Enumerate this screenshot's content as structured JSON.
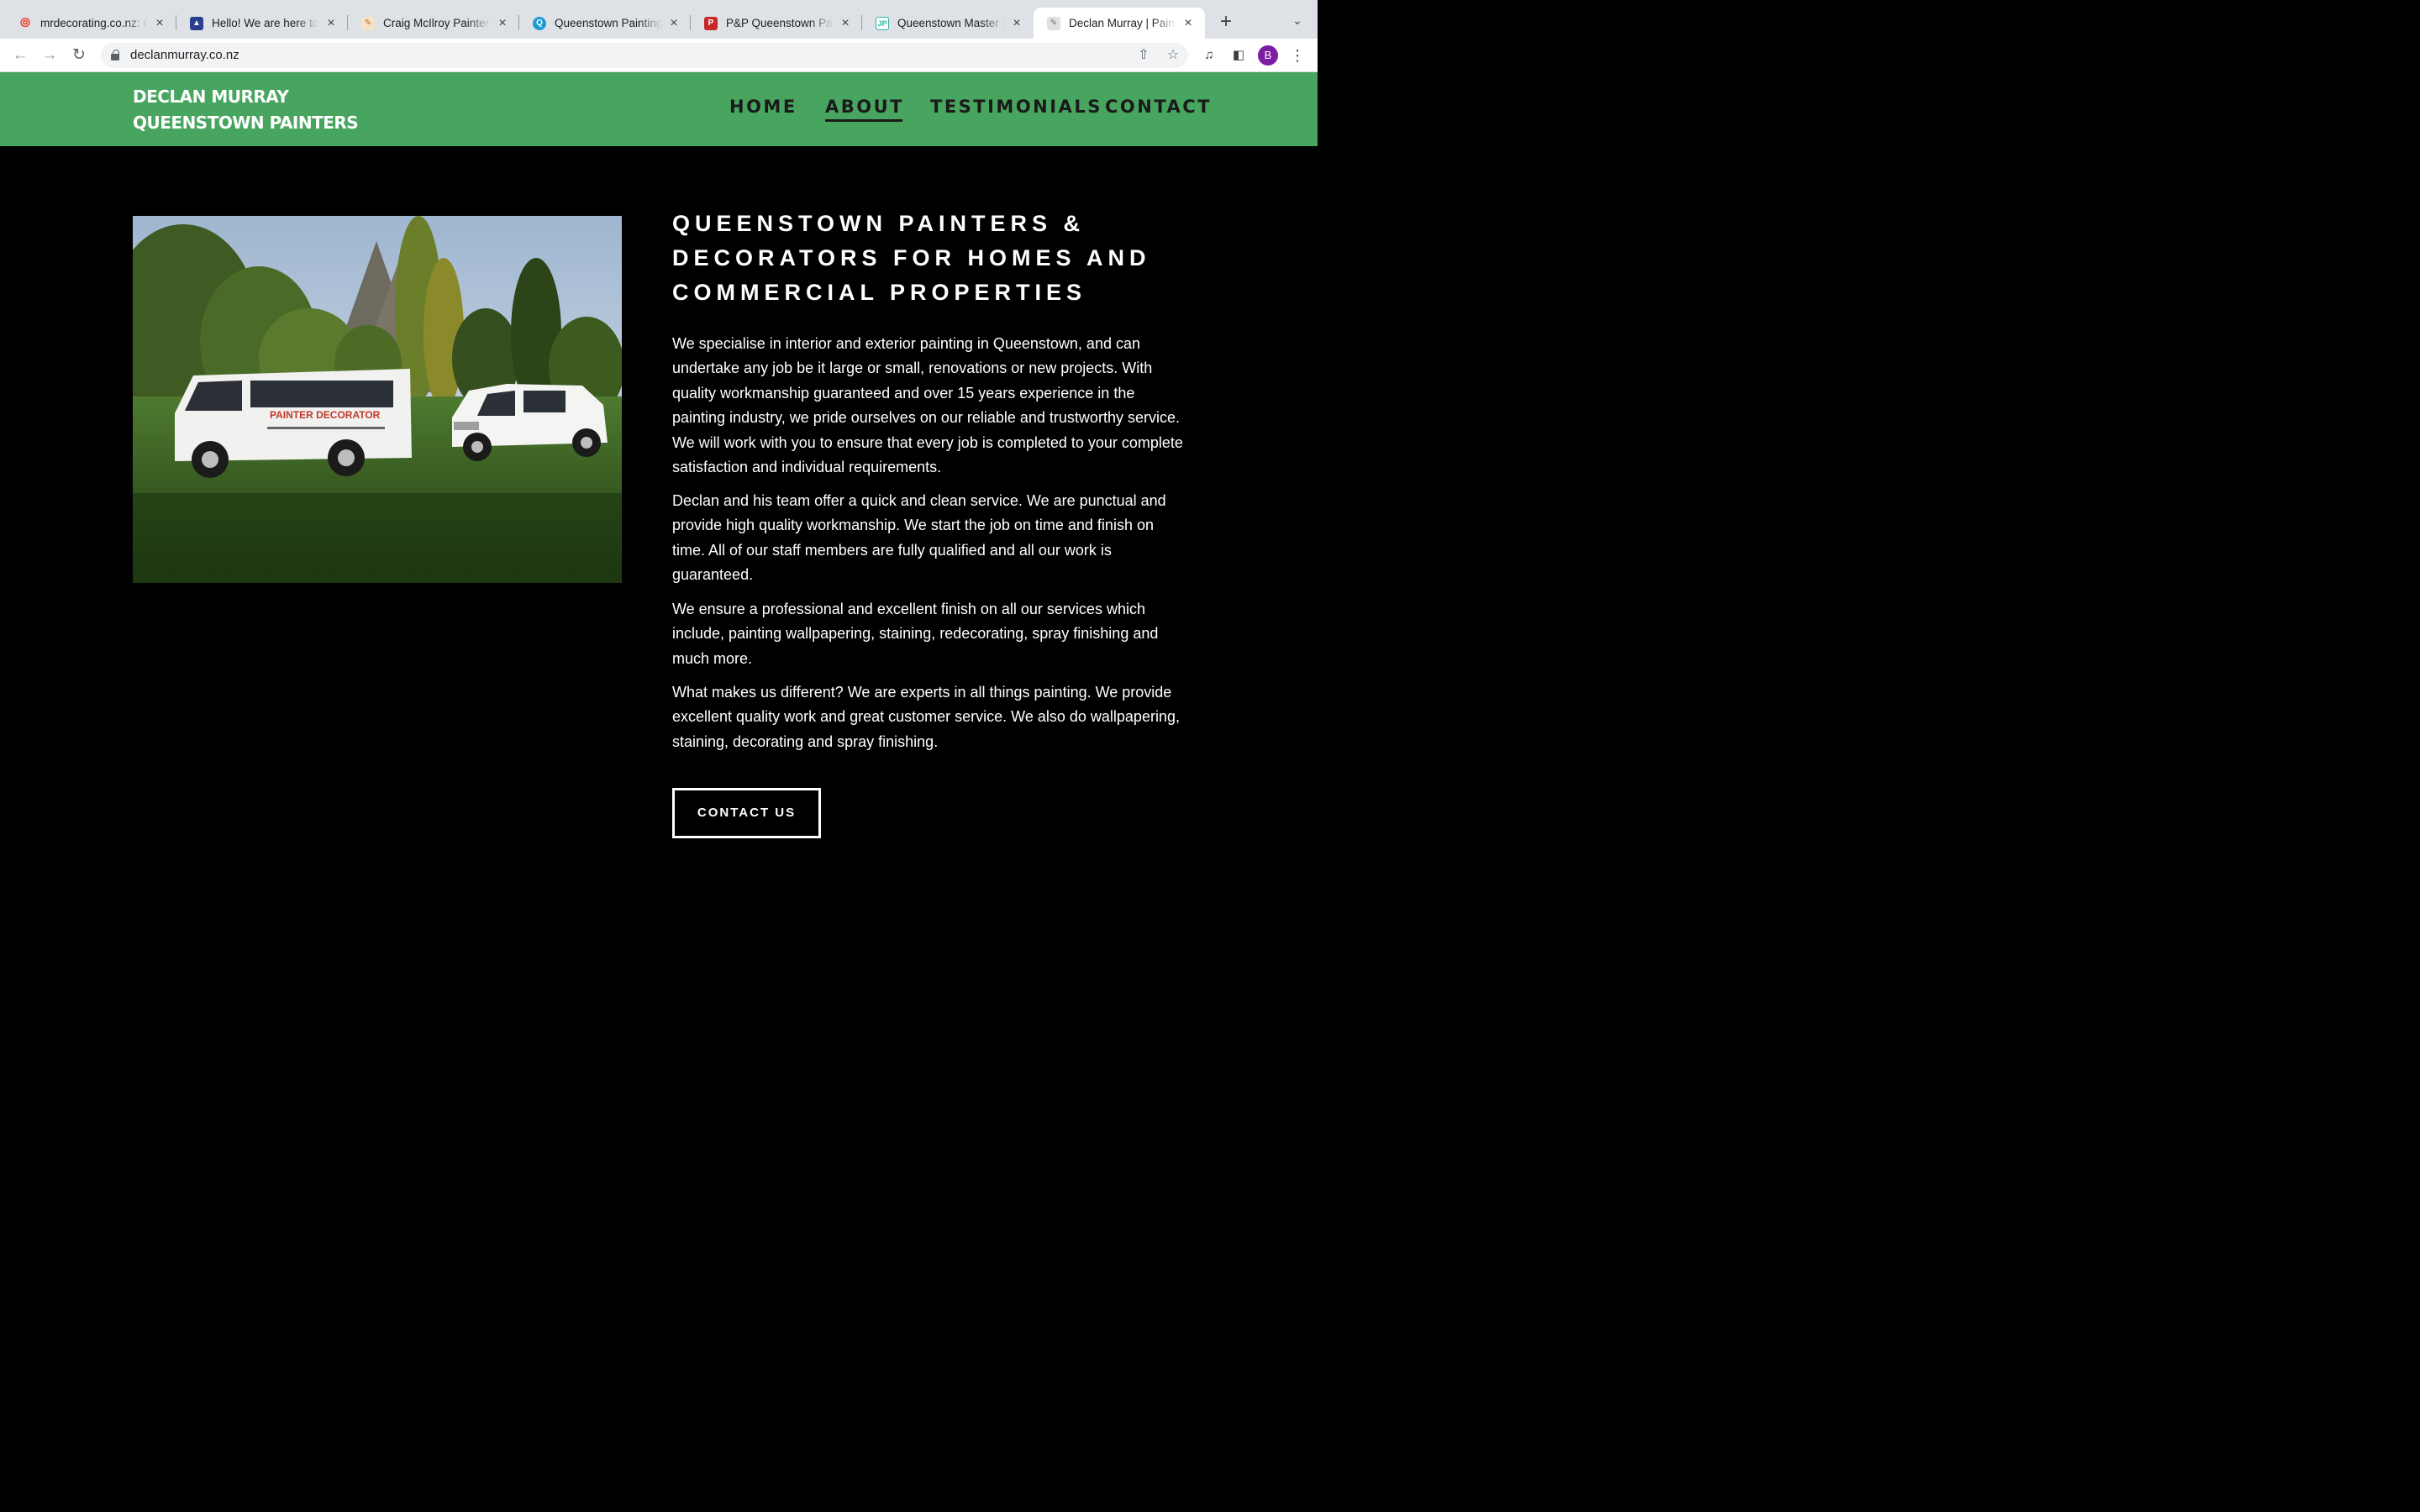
{
  "browser": {
    "tabs": [
      {
        "title": "mrdecorating.co.nz: C",
        "favicon": "swirl-icon",
        "color": "#ea4335"
      },
      {
        "title": "Hello! We are here to",
        "favicon": "shield-icon",
        "color": "#2a3f8f"
      },
      {
        "title": "Craig McIlroy Painters",
        "favicon": "paintbrush-icon",
        "color": "#b86b2a"
      },
      {
        "title": "Queenstown Painting",
        "favicon": "q-icon",
        "color": "#1e9bd7"
      },
      {
        "title": "P&P Queenstown Pain",
        "favicon": "pp-icon",
        "color": "#c62828"
      },
      {
        "title": "Queenstown Master P",
        "favicon": "jp-icon",
        "color": "#2bb3a6"
      },
      {
        "title": "Declan Murray | Paint",
        "favicon": "painter-icon",
        "color": "#9e9e9e",
        "active": true
      }
    ],
    "url": "declanmurray.co.nz",
    "profile_initial": "B"
  },
  "site": {
    "brand_line1": "DECLAN MURRAY",
    "brand_line2": "QUEENSTOWN PAINTERS",
    "nav": [
      {
        "label": "HOME"
      },
      {
        "label": "ABOUT",
        "active": true
      },
      {
        "label": "TESTIMONIALS"
      },
      {
        "label": "CONTACT"
      }
    ],
    "headline": "QUEENSTOWN PAINTERS & DECORATORS FOR HOMES AND COMMERCIAL PROPERTIES",
    "image_van_text": "PAINTER DECORATOR",
    "paragraphs": [
      "We specialise in interior and exterior painting in Queenstown, and can undertake any job be it large or small, renovations or new projects. With quality workmanship guaranteed and over 15 years experience in the painting industry, we pride ourselves on our reliable and trustworthy service. We will work with you to ensure that every job is completed to your complete satisfaction and individual requirements.",
      "Declan and his team offer a quick and clean service. We are punctual and provide high quality workmanship. We start the job on time and finish on time. All of our staff members are fully qualified and all our work is guaranteed.",
      "We ensure a professional and excellent finish on all our services which include, painting wallpapering, staining, redecorating, spray finishing and much more.",
      "What makes us different? We are experts in all things painting. We provide excellent quality work and great customer service. We also do wallpapering, staining, decorating and spray finishing."
    ],
    "cta_label": "CONTACT US",
    "colors": {
      "header_green": "#47a55f",
      "background": "#000000",
      "text": "#ffffff"
    }
  }
}
